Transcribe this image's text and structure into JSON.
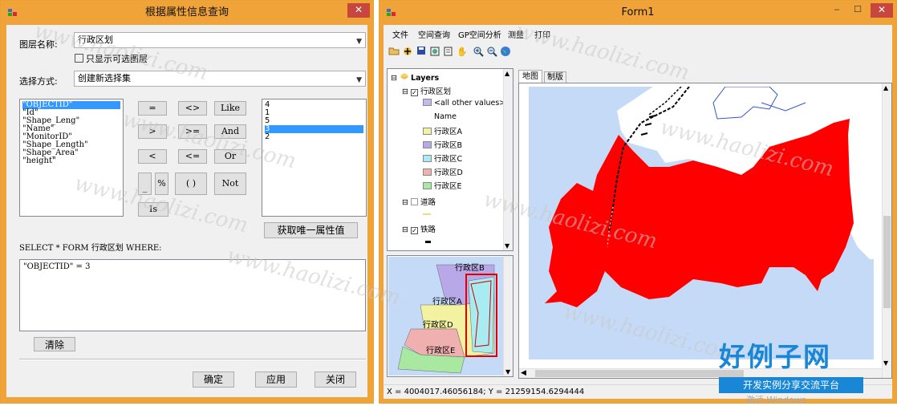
{
  "dialog": {
    "title": "根据属性信息查询",
    "close_glyph": "✕",
    "layer_label": "图层名称:",
    "layer_value": "行政区划",
    "only_selectable_label": "只显示可选图层",
    "method_label": "选择方式:",
    "method_value": "创建新选择集",
    "fields": [
      "\"OBJECTID\"",
      "\"Id\"",
      "\"Shape_Leng\"",
      "\"Name\"",
      "\"MonitorID\"",
      "\"Shape_Length\"",
      "\"Shape_Area\"",
      "\"height\""
    ],
    "operators": {
      "eq": "=",
      "ne": "<>",
      "like": "Like",
      "gt": ">",
      "ge": ">=",
      "and": "And",
      "lt": "<",
      "le": "<=",
      "or": "Or",
      "underscore": "_",
      "percent": "%",
      "paren": "( )",
      "not": "Not",
      "is": "Is"
    },
    "values": [
      "4",
      "1",
      "5",
      "3",
      "2"
    ],
    "unique_button": "获取唯一属性值",
    "sql_prefix": "SELECT * FORM  行政区划 WHERE:",
    "expression": "\"OBJECTID\" = 3",
    "clear_button": "清除",
    "ok_button": "确定",
    "apply_button": "应用",
    "close_button": "关闭"
  },
  "main": {
    "title": "Form1",
    "menu": [
      "文件",
      "空间查询",
      "GP空间分析",
      "测量",
      "打印"
    ],
    "toolbar_icons": [
      "open-icon",
      "add-data-icon",
      "save-icon",
      "full-extent-icon",
      "identify-icon",
      "pan-icon",
      "zoom-in-icon",
      "zoom-out-icon",
      "globe-icon"
    ],
    "toc": {
      "root": "Layers",
      "layer1": "行政区划",
      "other_values": "<all other values>",
      "field_name": "Name",
      "classes": [
        "行政区A",
        "行政区B",
        "行政区C",
        "行政区D",
        "行政区E"
      ],
      "layer2": "道路",
      "layer3": "铁路"
    },
    "tabs": [
      "地图",
      "制版"
    ],
    "overview_labels": [
      "行政区B",
      "行政区A",
      "行政区D",
      "行政区E"
    ],
    "status": "X = 4004017.46056184;  Y = 21259154.6294444"
  },
  "colors": {
    "titlebar": "#f0a338",
    "close_red": "#c7463e",
    "selection": "#3399ff",
    "water": "#c5daf6",
    "selected_polygon": "#ff0000",
    "class_a": "#f2f2a0",
    "class_b": "#b9a8e8",
    "class_c": "#a8ecf2",
    "class_d": "#f0b0b0",
    "class_e": "#a8e8a0",
    "other": "#c4b8ec",
    "watermark_brand": "#1a86d6"
  },
  "watermark": {
    "text": "www.haolizi.com",
    "brand_title": "好例子网",
    "brand_sub": "开发实例分享交流平台",
    "activate": "激活 Windows"
  }
}
